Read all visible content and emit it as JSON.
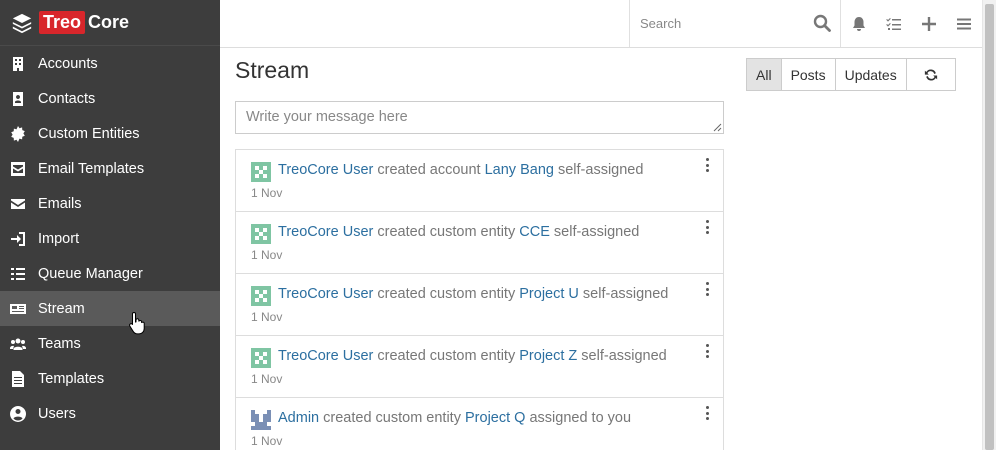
{
  "brand": {
    "part1": "Treo",
    "part2": "Core"
  },
  "sidebar": {
    "items": [
      {
        "label": "Accounts",
        "icon": "building-icon"
      },
      {
        "label": "Contacts",
        "icon": "contact-card-icon"
      },
      {
        "label": "Custom Entities",
        "icon": "gear-icon"
      },
      {
        "label": "Email Templates",
        "icon": "envelope-square-icon"
      },
      {
        "label": "Emails",
        "icon": "envelope-icon"
      },
      {
        "label": "Import",
        "icon": "sign-in-icon"
      },
      {
        "label": "Queue Manager",
        "icon": "list-check-icon"
      },
      {
        "label": "Stream",
        "icon": "newspaper-icon",
        "active": true
      },
      {
        "label": "Teams",
        "icon": "users-icon"
      },
      {
        "label": "Templates",
        "icon": "file-icon"
      },
      {
        "label": "Users",
        "icon": "user-circle-icon"
      }
    ]
  },
  "topbar": {
    "search_placeholder": "Search",
    "icons": [
      "bell-icon",
      "tasks-icon",
      "plus-icon",
      "menu-icon"
    ]
  },
  "main": {
    "title": "Stream",
    "filters": [
      {
        "label": "All",
        "active": true
      },
      {
        "label": "Posts",
        "active": false
      },
      {
        "label": "Updates",
        "active": false
      }
    ],
    "message_placeholder": "Write your message here",
    "colors": {
      "link": "#2c6fa0",
      "sidebar": "#3d3d3d",
      "brand": "#d8262b"
    }
  },
  "stream": [
    {
      "user": "TreoCore User",
      "action": "created account",
      "entity": "Lany Bang",
      "suffix": "self-assigned",
      "date": "1 Nov",
      "avatar": "green"
    },
    {
      "user": "TreoCore User",
      "action": "created custom entity",
      "entity": "CCE",
      "suffix": "self-assigned",
      "date": "1 Nov",
      "avatar": "green"
    },
    {
      "user": "TreoCore User",
      "action": "created custom entity",
      "entity": "Project U",
      "suffix": "self-assigned",
      "date": "1 Nov",
      "avatar": "green"
    },
    {
      "user": "TreoCore User",
      "action": "created custom entity",
      "entity": "Project Z",
      "suffix": "self-assigned",
      "date": "1 Nov",
      "avatar": "green"
    },
    {
      "user": "Admin",
      "action": "created custom entity",
      "entity": "Project Q",
      "suffix": "assigned to you",
      "date": "1 Nov",
      "avatar": "blue"
    }
  ]
}
